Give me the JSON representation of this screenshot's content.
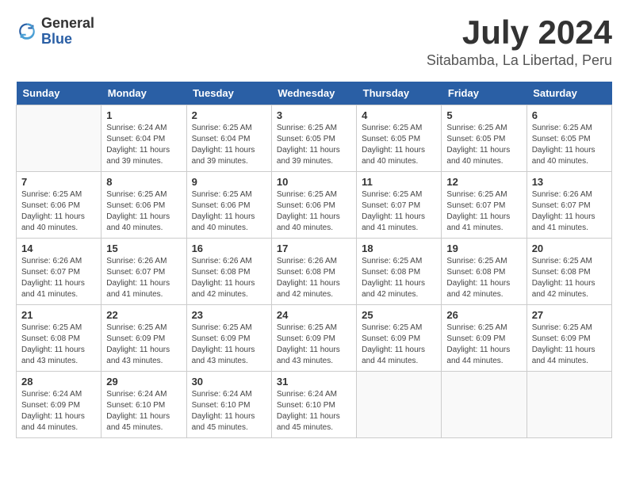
{
  "header": {
    "logo_general": "General",
    "logo_blue": "Blue",
    "month_year": "July 2024",
    "location": "Sitabamba, La Libertad, Peru"
  },
  "weekdays": [
    "Sunday",
    "Monday",
    "Tuesday",
    "Wednesday",
    "Thursday",
    "Friday",
    "Saturday"
  ],
  "weeks": [
    [
      {
        "day": "",
        "info": ""
      },
      {
        "day": "1",
        "info": "Sunrise: 6:24 AM\nSunset: 6:04 PM\nDaylight: 11 hours\nand 39 minutes."
      },
      {
        "day": "2",
        "info": "Sunrise: 6:25 AM\nSunset: 6:04 PM\nDaylight: 11 hours\nand 39 minutes."
      },
      {
        "day": "3",
        "info": "Sunrise: 6:25 AM\nSunset: 6:05 PM\nDaylight: 11 hours\nand 39 minutes."
      },
      {
        "day": "4",
        "info": "Sunrise: 6:25 AM\nSunset: 6:05 PM\nDaylight: 11 hours\nand 40 minutes."
      },
      {
        "day": "5",
        "info": "Sunrise: 6:25 AM\nSunset: 6:05 PM\nDaylight: 11 hours\nand 40 minutes."
      },
      {
        "day": "6",
        "info": "Sunrise: 6:25 AM\nSunset: 6:05 PM\nDaylight: 11 hours\nand 40 minutes."
      }
    ],
    [
      {
        "day": "7",
        "info": "Sunrise: 6:25 AM\nSunset: 6:06 PM\nDaylight: 11 hours\nand 40 minutes."
      },
      {
        "day": "8",
        "info": "Sunrise: 6:25 AM\nSunset: 6:06 PM\nDaylight: 11 hours\nand 40 minutes."
      },
      {
        "day": "9",
        "info": "Sunrise: 6:25 AM\nSunset: 6:06 PM\nDaylight: 11 hours\nand 40 minutes."
      },
      {
        "day": "10",
        "info": "Sunrise: 6:25 AM\nSunset: 6:06 PM\nDaylight: 11 hours\nand 40 minutes."
      },
      {
        "day": "11",
        "info": "Sunrise: 6:25 AM\nSunset: 6:07 PM\nDaylight: 11 hours\nand 41 minutes."
      },
      {
        "day": "12",
        "info": "Sunrise: 6:25 AM\nSunset: 6:07 PM\nDaylight: 11 hours\nand 41 minutes."
      },
      {
        "day": "13",
        "info": "Sunrise: 6:26 AM\nSunset: 6:07 PM\nDaylight: 11 hours\nand 41 minutes."
      }
    ],
    [
      {
        "day": "14",
        "info": "Sunrise: 6:26 AM\nSunset: 6:07 PM\nDaylight: 11 hours\nand 41 minutes."
      },
      {
        "day": "15",
        "info": "Sunrise: 6:26 AM\nSunset: 6:07 PM\nDaylight: 11 hours\nand 41 minutes."
      },
      {
        "day": "16",
        "info": "Sunrise: 6:26 AM\nSunset: 6:08 PM\nDaylight: 11 hours\nand 42 minutes."
      },
      {
        "day": "17",
        "info": "Sunrise: 6:26 AM\nSunset: 6:08 PM\nDaylight: 11 hours\nand 42 minutes."
      },
      {
        "day": "18",
        "info": "Sunrise: 6:25 AM\nSunset: 6:08 PM\nDaylight: 11 hours\nand 42 minutes."
      },
      {
        "day": "19",
        "info": "Sunrise: 6:25 AM\nSunset: 6:08 PM\nDaylight: 11 hours\nand 42 minutes."
      },
      {
        "day": "20",
        "info": "Sunrise: 6:25 AM\nSunset: 6:08 PM\nDaylight: 11 hours\nand 42 minutes."
      }
    ],
    [
      {
        "day": "21",
        "info": "Sunrise: 6:25 AM\nSunset: 6:08 PM\nDaylight: 11 hours\nand 43 minutes."
      },
      {
        "day": "22",
        "info": "Sunrise: 6:25 AM\nSunset: 6:09 PM\nDaylight: 11 hours\nand 43 minutes."
      },
      {
        "day": "23",
        "info": "Sunrise: 6:25 AM\nSunset: 6:09 PM\nDaylight: 11 hours\nand 43 minutes."
      },
      {
        "day": "24",
        "info": "Sunrise: 6:25 AM\nSunset: 6:09 PM\nDaylight: 11 hours\nand 43 minutes."
      },
      {
        "day": "25",
        "info": "Sunrise: 6:25 AM\nSunset: 6:09 PM\nDaylight: 11 hours\nand 44 minutes."
      },
      {
        "day": "26",
        "info": "Sunrise: 6:25 AM\nSunset: 6:09 PM\nDaylight: 11 hours\nand 44 minutes."
      },
      {
        "day": "27",
        "info": "Sunrise: 6:25 AM\nSunset: 6:09 PM\nDaylight: 11 hours\nand 44 minutes."
      }
    ],
    [
      {
        "day": "28",
        "info": "Sunrise: 6:24 AM\nSunset: 6:09 PM\nDaylight: 11 hours\nand 44 minutes."
      },
      {
        "day": "29",
        "info": "Sunrise: 6:24 AM\nSunset: 6:10 PM\nDaylight: 11 hours\nand 45 minutes."
      },
      {
        "day": "30",
        "info": "Sunrise: 6:24 AM\nSunset: 6:10 PM\nDaylight: 11 hours\nand 45 minutes."
      },
      {
        "day": "31",
        "info": "Sunrise: 6:24 AM\nSunset: 6:10 PM\nDaylight: 11 hours\nand 45 minutes."
      },
      {
        "day": "",
        "info": ""
      },
      {
        "day": "",
        "info": ""
      },
      {
        "day": "",
        "info": ""
      }
    ]
  ]
}
